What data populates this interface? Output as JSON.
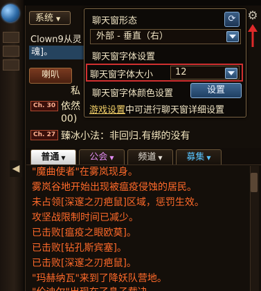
{
  "window": {
    "channel_select": "系统",
    "name_line": "Clown9从灵",
    "selected_line": "魂]。",
    "speaker_button": "喇叭"
  },
  "popup": {
    "title": "聊天窗形态",
    "direction_value": "外部 - 垂直（右）",
    "font_settings_label": "聊天窗字体设置",
    "font_size_label": "聊天窗字体大小",
    "font_size_value": "12",
    "font_color_label": "聊天窗字体颜色设置",
    "set_button": "设置",
    "game_settings_link": "游戏设置",
    "game_settings_rest": "中可进行聊天窗详细设置"
  },
  "messages": [
    {
      "text": "私"
    },
    {
      "level": "Ch. 30",
      "text": "依然"
    },
    {
      "text": "00)"
    },
    {
      "level": "Ch. 27",
      "text": "臻冰小法：非回归.有绑的没有"
    }
  ],
  "tabs": [
    {
      "label": "普通"
    },
    {
      "label": "公会"
    },
    {
      "label": "频道"
    },
    {
      "label": "募集"
    }
  ],
  "chat_log": [
    "\"魔曲使者\"在雾岚现身。",
    "雾岚谷地开始出现被瘟疫侵蚀的居民。",
    "未占领[深邃之刃疤鼠]区域，惩罚生效。",
    "攻坚战限制时间已减少。",
    "已击败[瘟疫之眼欧莫]。",
    "已击败[钻孔斯宾塞]。",
    "已击败[深邃之刃疤鼠]。",
    "\"玛赫纳瓦\"来到了降妖队营地。",
    "\"伦迪尔\"出现在了鼻子载决。"
  ],
  "colors": {
    "log_text": "#ff6a2a",
    "highlight_border": "#d23030",
    "guild_tab": "#e38cf3",
    "recruit_tab": "#58c4ff"
  }
}
